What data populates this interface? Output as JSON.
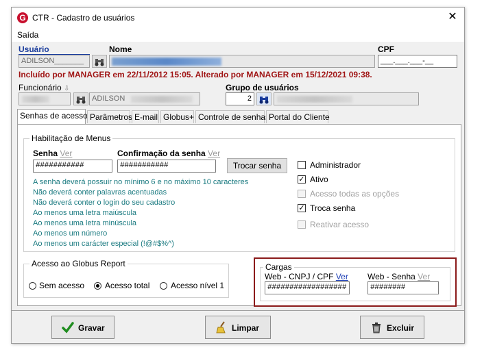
{
  "window": {
    "title": "CTR - Cadastro de usuários",
    "menu": {
      "saida": "Saída"
    }
  },
  "header": {
    "usuario_label": "Usuário",
    "usuario_value": "ADILSON_______",
    "nome_label": "Nome",
    "cpf_label": "CPF",
    "cpf_value": "___.___.___-__",
    "audit_text": "Incluído por MANAGER em 22/11/2012 15:05. Alterado por MANAGER em 15/12/2021 09:38.",
    "funcionario_label": "Funcionário",
    "funcionario_name": "ADILSON",
    "grupo_label": "Grupo de usuários",
    "grupo_value": "2"
  },
  "tabs": [
    {
      "label": "Senhas de acesso"
    },
    {
      "label": "Parâmetros"
    },
    {
      "label": "E-mail"
    },
    {
      "label": "Globus+"
    },
    {
      "label": "Controle de senhas"
    },
    {
      "label": "Portal do Cliente"
    }
  ],
  "habilitacao": {
    "title": "Habilitação de Menus",
    "senha_label": "Senha",
    "ver": "Ver",
    "confirmacao_label": "Confirmação da senha",
    "senha_value": "###########",
    "confirmacao_value": "###########",
    "trocar_button": "Trocar senha",
    "rules": [
      "A senha deverá possuir no mínimo 6 e no máximo 10 caracteres",
      "Não deverá conter palavras acentuadas",
      "Não deverá conter o login do seu cadastro",
      "Ao menos uma letra maiúscula",
      "Ao menos uma letra minúscula",
      "Ao menos um número",
      "Ao menos um carácter especial (!@#$%^)"
    ]
  },
  "checkboxes": {
    "administrador": "Administrador",
    "ativo": "Ativo",
    "acesso_todas": "Acesso todas as opções",
    "troca_senha": "Troca senha",
    "reativar": "Reativar acesso"
  },
  "globus_report": {
    "title": "Acesso ao Globus Report",
    "sem_acesso": "Sem acesso",
    "acesso_total": "Acesso total",
    "acesso_nivel": "Acesso nível 1"
  },
  "cargas": {
    "title": "Cargas",
    "cnpj_label": "Web - CNPJ / CPF",
    "ver": "Ver",
    "senha_label": "Web - Senha",
    "cnpj_value": "##################",
    "senha_value": "########",
    "highlight_color": "#8b1a1a"
  },
  "footer": {
    "gravar": "Gravar",
    "limpar": "Limpar",
    "excluir": "Excluir"
  }
}
